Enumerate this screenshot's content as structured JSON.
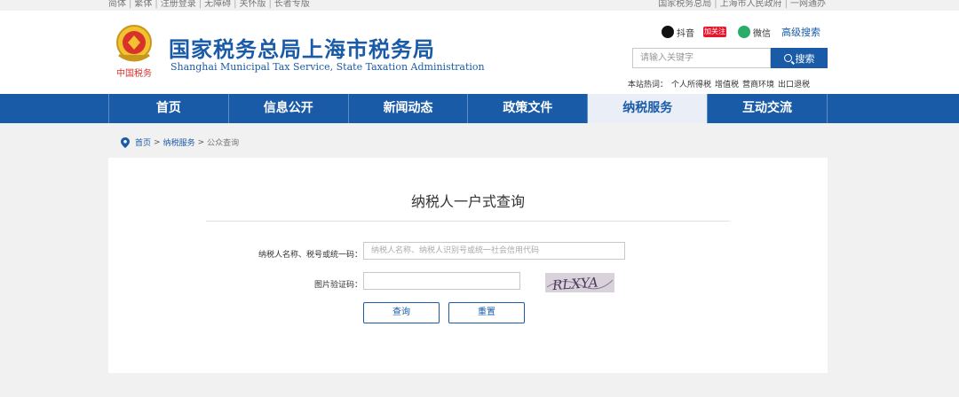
{
  "topbar": {
    "left": [
      "简体",
      "繁体",
      "注册登录",
      "无障碍",
      "关怀版",
      "长者专版"
    ],
    "right": [
      "国家税务总局",
      "上海市人民政府",
      "一网通办"
    ]
  },
  "header": {
    "title": "国家税务总局上海市税务局",
    "subtitle": "Shanghai Municipal Tax Service, State Taxation Administration",
    "emblem_caption": "中国税务",
    "social": {
      "douyin": "抖音",
      "weibo_badge": "加关注",
      "wechat": "微信",
      "advanced_search": "高级搜索"
    },
    "search": {
      "placeholder": "请输入关键字",
      "button": "搜索"
    },
    "hotwords": {
      "label": "本站热词：",
      "items": [
        "个人所得税",
        "增值税",
        "营商环境",
        "出口退税"
      ]
    }
  },
  "nav": {
    "items": [
      "首页",
      "信息公开",
      "新闻动态",
      "政策文件",
      "纳税服务",
      "互动交流"
    ],
    "active_index": 4
  },
  "breadcrumb": {
    "home": "首页",
    "section": "纳税服务",
    "current": "公众查询"
  },
  "form": {
    "title": "纳税人一户式查询",
    "name_label": "纳税人名称、税号或统一码：",
    "name_placeholder": "纳税人名称、纳税人识别号或统一社会信用代码",
    "captcha_label": "图片验证码：",
    "captcha_text": "RLXYA",
    "query_button": "查询",
    "reset_button": "重置"
  },
  "colors": {
    "brand": "#1a5ba8",
    "nav_active_bg": "#e9eef7",
    "weibo": "#e6162d",
    "wechat": "#2aae67"
  }
}
